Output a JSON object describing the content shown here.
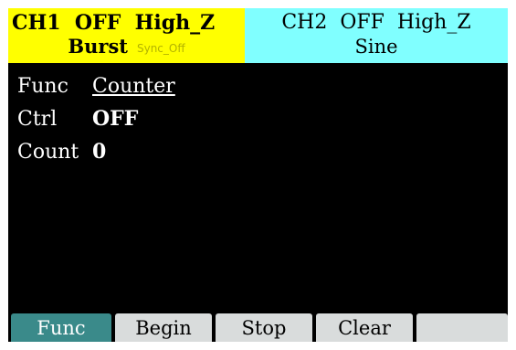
{
  "ch1": {
    "status": "CH1  OFF  High_Z",
    "mode": "Burst",
    "sync": "Sync_Off"
  },
  "ch2": {
    "status": "CH2  OFF  High_Z",
    "mode": "Sine"
  },
  "params": [
    {
      "label": "Func",
      "value": "Counter"
    },
    {
      "label": "Ctrl",
      "value": "OFF"
    },
    {
      "label": "Count",
      "value": "0"
    }
  ],
  "softkeys": [
    {
      "label": "Func",
      "active": true
    },
    {
      "label": "Begin",
      "active": false
    },
    {
      "label": "Stop",
      "active": false
    },
    {
      "label": "Clear",
      "active": false
    },
    {
      "label": "",
      "active": false
    }
  ],
  "colors": {
    "ch1_bg": "#ffff00",
    "ch2_bg": "#80ffff",
    "screen_bg": "#000000",
    "active_key": "#3a8a8a",
    "inactive_key": "#d9dcdc"
  }
}
